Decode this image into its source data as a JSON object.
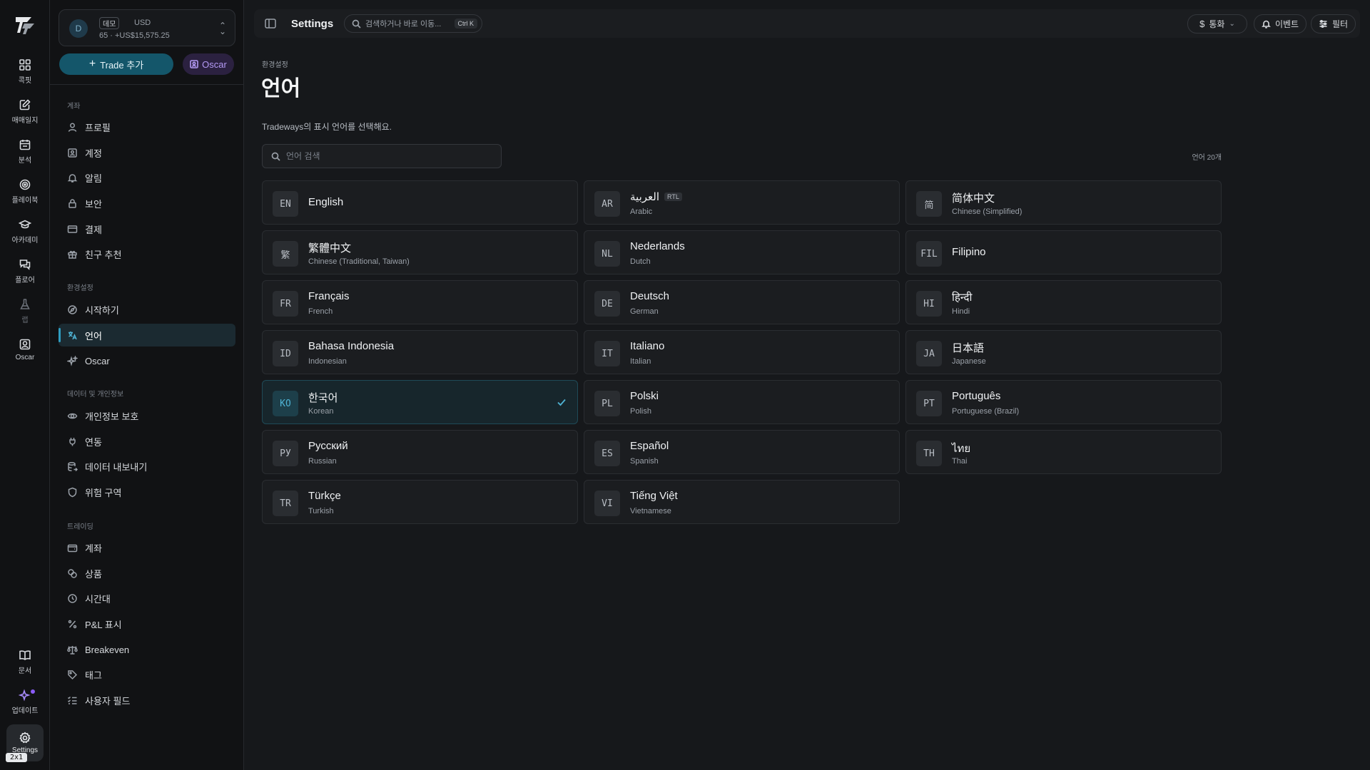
{
  "rail": {
    "items": [
      {
        "label": "콕핏"
      },
      {
        "label": "매매일지"
      },
      {
        "label": "분석"
      },
      {
        "label": "플레이북"
      },
      {
        "label": "아카데미"
      },
      {
        "label": "플로어"
      },
      {
        "label": "랩"
      },
      {
        "label": "Oscar"
      },
      {
        "label": "문서"
      },
      {
        "label": "업데이트"
      },
      {
        "label": "Settings"
      }
    ],
    "badge": "2x1"
  },
  "account": {
    "avatar": "D",
    "tag": "데모",
    "currency": "USD",
    "balance": "65 · +US$15,575.25"
  },
  "sidebar": {
    "trade_button": "Trade 추가",
    "oscar_button": "Oscar",
    "sections": [
      {
        "title": "계좌",
        "items": [
          "프로필",
          "계정",
          "알림",
          "보안",
          "결제",
          "친구 추천"
        ]
      },
      {
        "title": "환경설정",
        "items": [
          "시작하기",
          "언어",
          "Oscar"
        ]
      },
      {
        "title": "데이터 및 개인정보",
        "items": [
          "개인정보 보호",
          "연동",
          "데이터 내보내기",
          "위험 구역"
        ]
      },
      {
        "title": "트레이딩",
        "items": [
          "계좌",
          "상품",
          "시간대",
          "P&L 표시",
          "Breakeven",
          "태그",
          "사용자 필드"
        ]
      }
    ]
  },
  "topbar": {
    "title": "Settings",
    "search_placeholder": "검색하거나 바로 이동...",
    "shortcut": "Ctrl K",
    "currency_label": "통화",
    "events_label": "이벤트",
    "filter_label": "필터"
  },
  "main": {
    "breadcrumb": "환경설정",
    "title": "언어",
    "description": "Tradeways의 표시 언어를 선택해요.",
    "search_placeholder": "언어 검색",
    "count": "언어 20개",
    "selected_code": "KO",
    "rtl_label": "RTL",
    "languages": [
      {
        "code": "EN",
        "native": "English",
        "english": ""
      },
      {
        "code": "AR",
        "native": "العربية",
        "english": "Arabic",
        "rtl": true
      },
      {
        "code": "简",
        "native": "简体中文",
        "english": "Chinese (Simplified)"
      },
      {
        "code": "繁",
        "native": "繁體中文",
        "english": "Chinese (Traditional, Taiwan)"
      },
      {
        "code": "NL",
        "native": "Nederlands",
        "english": "Dutch"
      },
      {
        "code": "FIL",
        "native": "Filipino",
        "english": ""
      },
      {
        "code": "FR",
        "native": "Français",
        "english": "French"
      },
      {
        "code": "DE",
        "native": "Deutsch",
        "english": "German"
      },
      {
        "code": "HI",
        "native": "हिन्दी",
        "english": "Hindi"
      },
      {
        "code": "ID",
        "native": "Bahasa Indonesia",
        "english": "Indonesian"
      },
      {
        "code": "IT",
        "native": "Italiano",
        "english": "Italian"
      },
      {
        "code": "JA",
        "native": "日本語",
        "english": "Japanese"
      },
      {
        "code": "KO",
        "native": "한국어",
        "english": "Korean"
      },
      {
        "code": "PL",
        "native": "Polski",
        "english": "Polish"
      },
      {
        "code": "PT",
        "native": "Português",
        "english": "Portuguese (Brazil)"
      },
      {
        "code": "РУ",
        "native": "Русский",
        "english": "Russian"
      },
      {
        "code": "ES",
        "native": "Español",
        "english": "Spanish"
      },
      {
        "code": "TH",
        "native": "ไทย",
        "english": "Thai"
      },
      {
        "code": "TR",
        "native": "Türkçe",
        "english": "Turkish"
      },
      {
        "code": "VI",
        "native": "Tiếng Việt",
        "english": "Vietnamese"
      }
    ]
  },
  "colors": {
    "accent": "#2f9cc0",
    "oscar_purple": "#b49af5",
    "background": "#16181b"
  }
}
